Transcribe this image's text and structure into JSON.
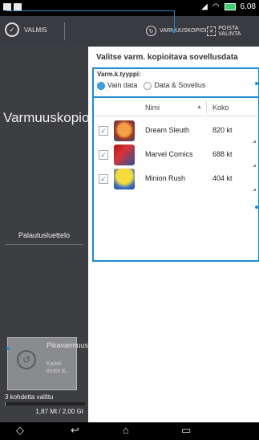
{
  "status": {
    "time": "6.08"
  },
  "actionbar": {
    "done_label": "VALMIS",
    "backup_label": "VARMUUSKOPIOI",
    "deselect_label": "POISTA VALINTA"
  },
  "left": {
    "title": "Varmuuskopiointiluettelo",
    "restore_link": "Palautusluettelo",
    "quick_title": "Pikavarmuusk...",
    "quick_sub": "Kaikki tiedot &...",
    "selected_count": "3 kohdetta valittu",
    "storage": "1,87 Mt / 2,00 Gt",
    "storage_fraction": 0.01
  },
  "right": {
    "title": "Valitse varm. kopioitava sovellusdata",
    "type_label": "Varm.k.tyyppi:",
    "option1": "Vain data",
    "option2": "Data & Sovellus",
    "col_name": "Nimi",
    "col_size": "Koko",
    "rows": [
      {
        "name": "Dream Sleuth",
        "size": "820 kt"
      },
      {
        "name": "Marvel Comics",
        "size": "688 kt"
      },
      {
        "name": "Minion Rush",
        "size": "404 kt"
      }
    ]
  },
  "colors": {
    "accent": "#1e8bd1",
    "sidebar": "#3d3e42",
    "actionbar": "#3a3b40"
  },
  "icons": {
    "status_left": [
      "notification-icon",
      "image-icon"
    ],
    "status_right": [
      "signal-icon",
      "wifi-icon",
      "battery-icon"
    ],
    "nav": [
      "back-icon",
      "home-icon",
      "recent-apps-icon"
    ]
  }
}
